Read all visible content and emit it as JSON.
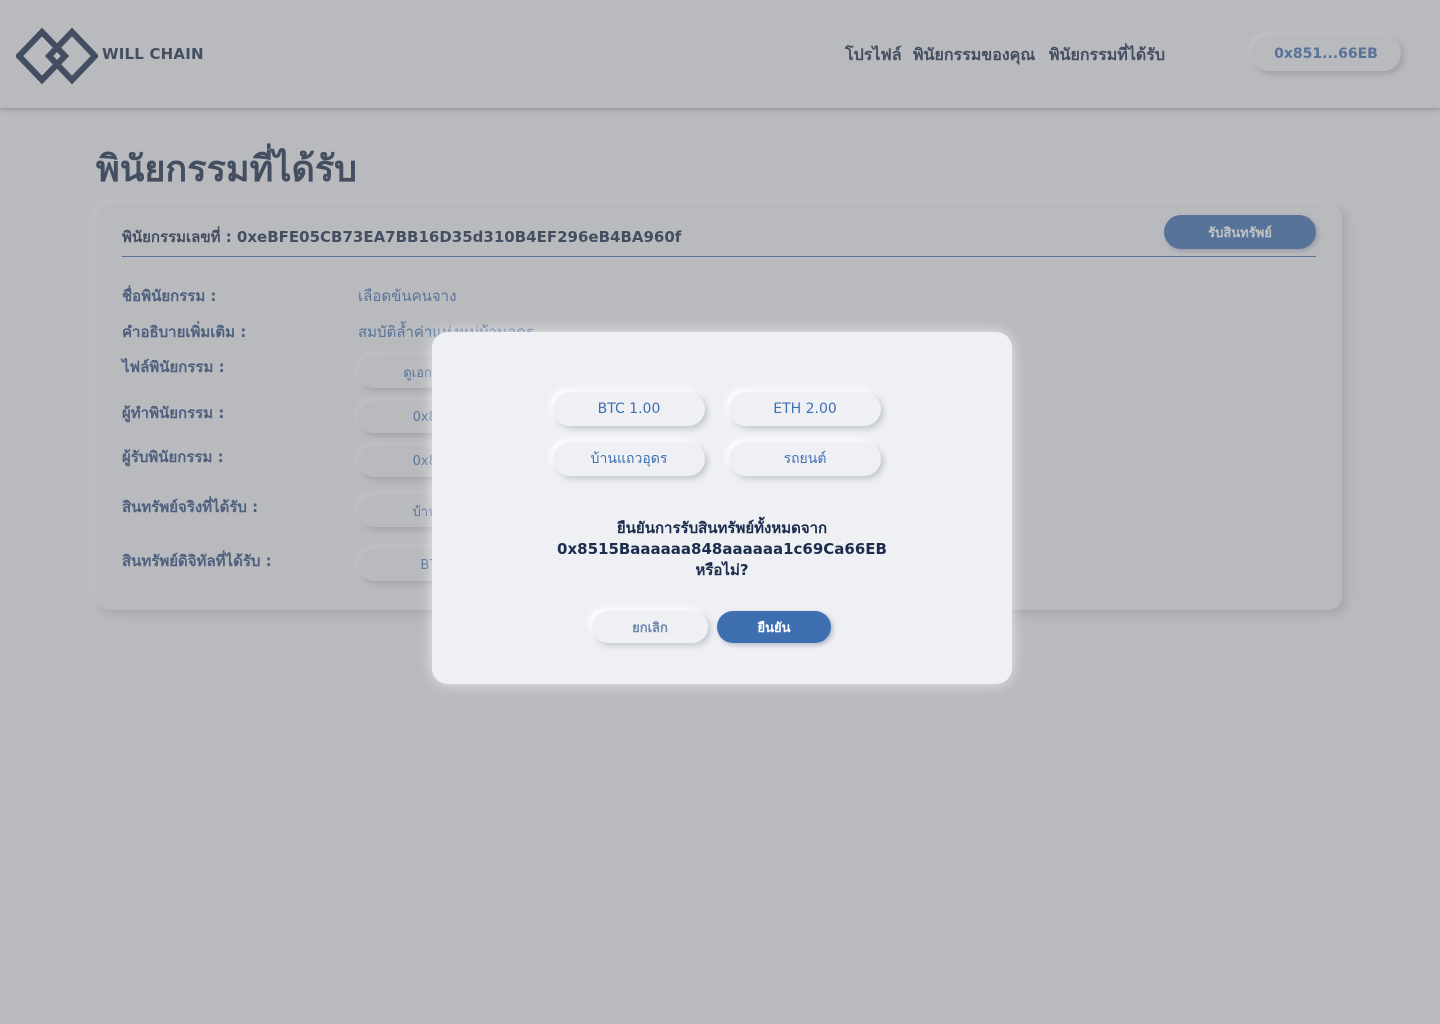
{
  "header": {
    "brand": "WILL CHAIN",
    "nav": [
      "โปรไฟล์",
      "พินัยกรรมของคุณ",
      "พินัยกรรมที่ได้รับ"
    ],
    "wallet": "0x851...66EB"
  },
  "page": {
    "title": "พินัยกรรมที่ได้รับ"
  },
  "card": {
    "tx_id": "พินัยกรรมเลขที่ : 0xeBFE05CB73EA7BB16D35d310B4EF296eB4BA960f",
    "claim_button": "รับสินทรัพย์",
    "labels": {
      "name": "ชื่อพินัยกรรม :",
      "description": "คำอธิบายเพิ่มเติม :",
      "file": "ไฟล์พินัยกรรม :",
      "creator": "ผู้ทำพินัยกรรม :",
      "beneficiary": "ผู้รับพินัยกรรม :",
      "real_assets": "สินทรัพย์จริงที่ได้รับ :",
      "digital_assets": "สินทรัพย์ดิจิทัลที่ได้รับ :"
    },
    "values": {
      "name": "เลือดข้นคนจาง",
      "description": "สมบัติล้ำค่าแห่งหมู่บ้านอุดร",
      "file": "ดูเอกสารพ",
      "creator": "0x851",
      "beneficiary": "0x851",
      "real_assets": "บ้านแถ",
      "digital_assets": "BTC"
    }
  },
  "modal": {
    "assets": [
      "BTC 1.00",
      "ETH 2.00",
      "บ้านแถวอุดร",
      "รถยนต์"
    ],
    "message": {
      "line1": "ยืนยันการรับสินทรัพย์ทั้งหมดจาก",
      "line2": "0x8515Baaaaaa848aaaaaa1c69Ca66EB",
      "line3": "หรือไม่?"
    },
    "cancel": "ยกเลิก",
    "confirm": "ยืนยัน"
  },
  "colors": {
    "accent": "#3e70b1",
    "navy": "#1b2c4c",
    "background": "#eff0f4",
    "overlay": "#bebec0"
  },
  "icons": {
    "logo": "will-chain-logo-icon"
  }
}
